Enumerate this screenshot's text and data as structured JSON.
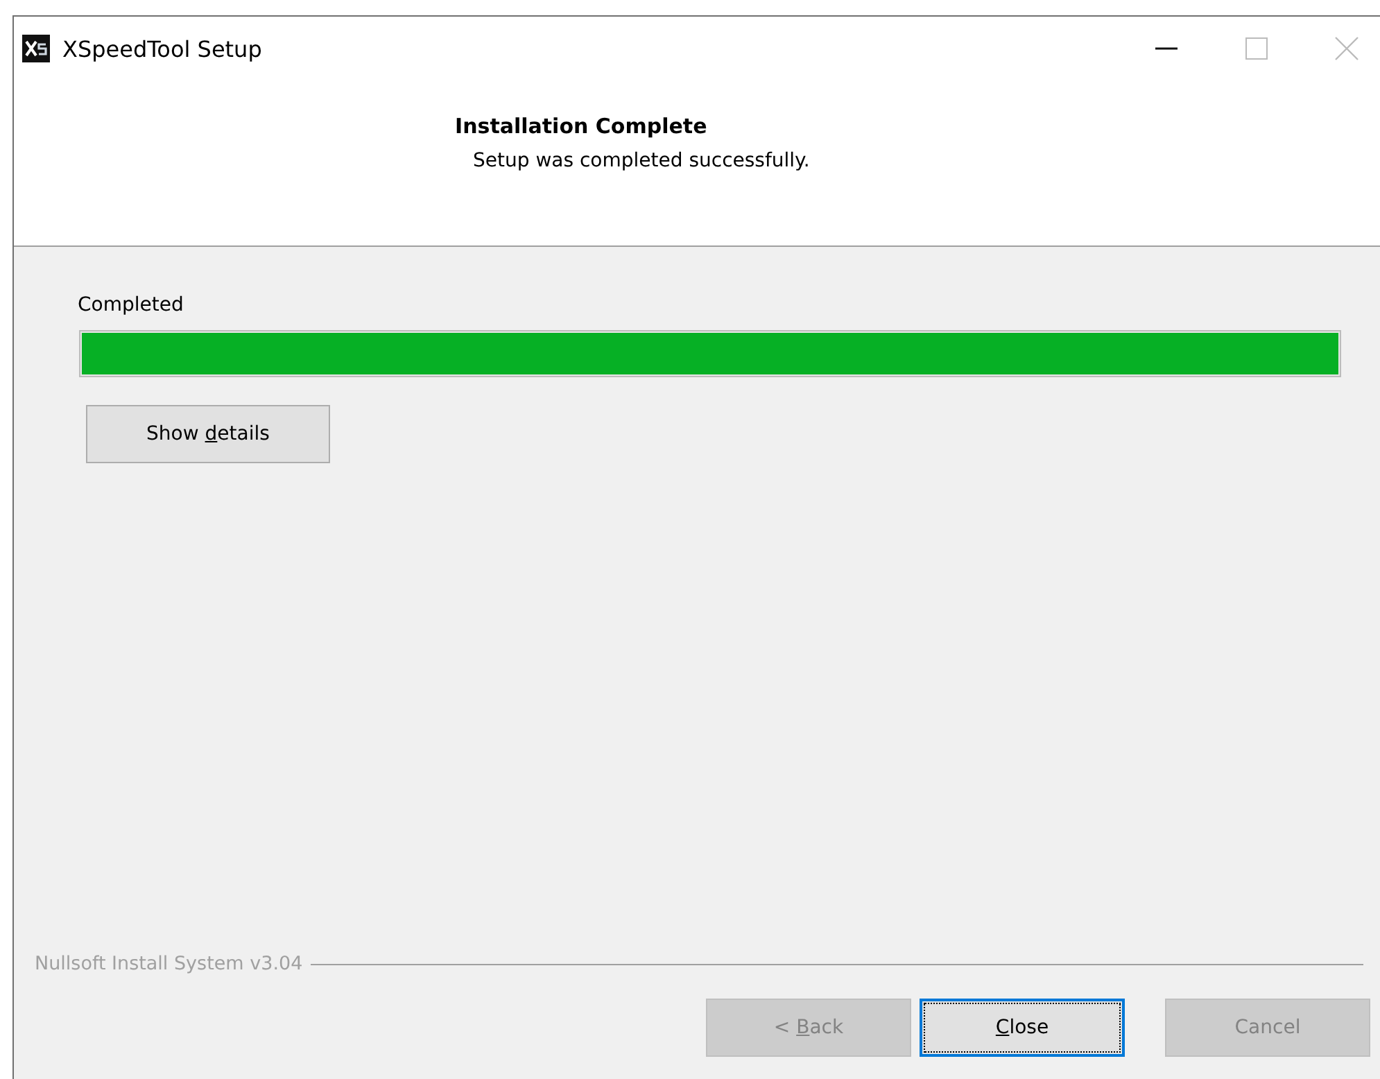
{
  "window": {
    "title": "XSpeedTool Setup"
  },
  "header": {
    "title": "Installation Complete",
    "subtitle": "Setup was completed successfully."
  },
  "progress": {
    "label": "Completed",
    "level": 1
  },
  "details_button": {
    "before": "Show ",
    "accel": "d",
    "after": "etails",
    "disabled": false
  },
  "branding": "Nullsoft Install System v3.04",
  "buttons": [
    {
      "before": "< ",
      "accel": "B",
      "after": "ack",
      "disabled": true,
      "focused": false
    },
    {
      "accel": "C",
      "after": "lose",
      "disabled": false,
      "focused": true
    },
    {
      "before": "Cancel",
      "disabled": true,
      "focused": false
    }
  ]
}
